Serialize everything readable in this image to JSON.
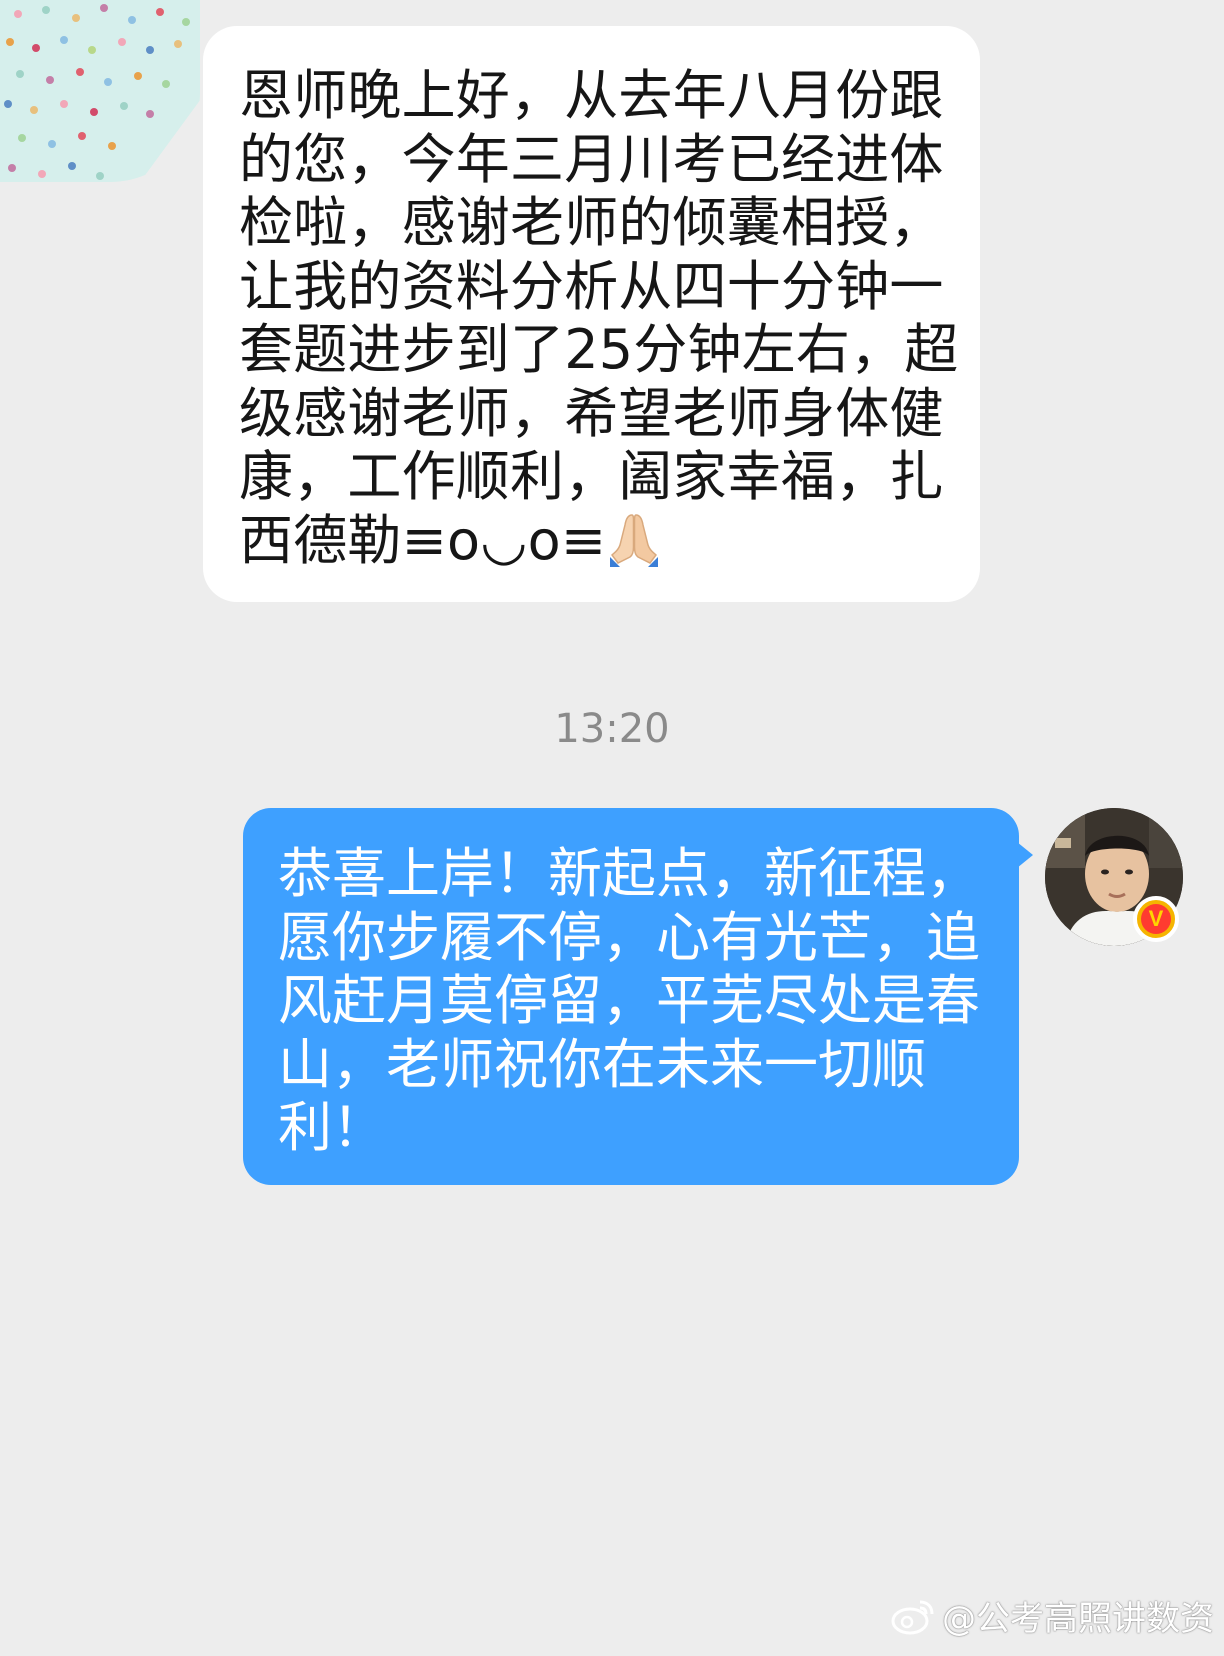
{
  "chat": {
    "messages": [
      {
        "direction": "received",
        "text": "恩师晚上好，从去年八月份跟的您，今年三月川考已经进体检啦，感谢老师的倾囊相授，让我的资料分析从四十分钟一套题进步到了25分钟左右，超级感谢老师，希望老师身体健康，工作顺利，阖家幸福，扎西德勒≡ο◡ο≡",
        "emoji_icon": "folded-hands-icon"
      },
      {
        "direction": "sent",
        "text": "恭喜上岸！新起点，新征程，愿你步履不停，心有光芒，追风赶月莫停留，平芜尽处是春山，老师祝你在未来一切顺利！"
      }
    ],
    "timestamp": "13:20",
    "verified_badge": "V"
  },
  "watermark": {
    "text": "@公考高照讲数资",
    "icon": "weibo-icon"
  },
  "colors": {
    "background": "#ededed",
    "received_bubble": "#ffffff",
    "sent_bubble": "#3ea0ff",
    "timestamp": "#8a8a8a"
  }
}
